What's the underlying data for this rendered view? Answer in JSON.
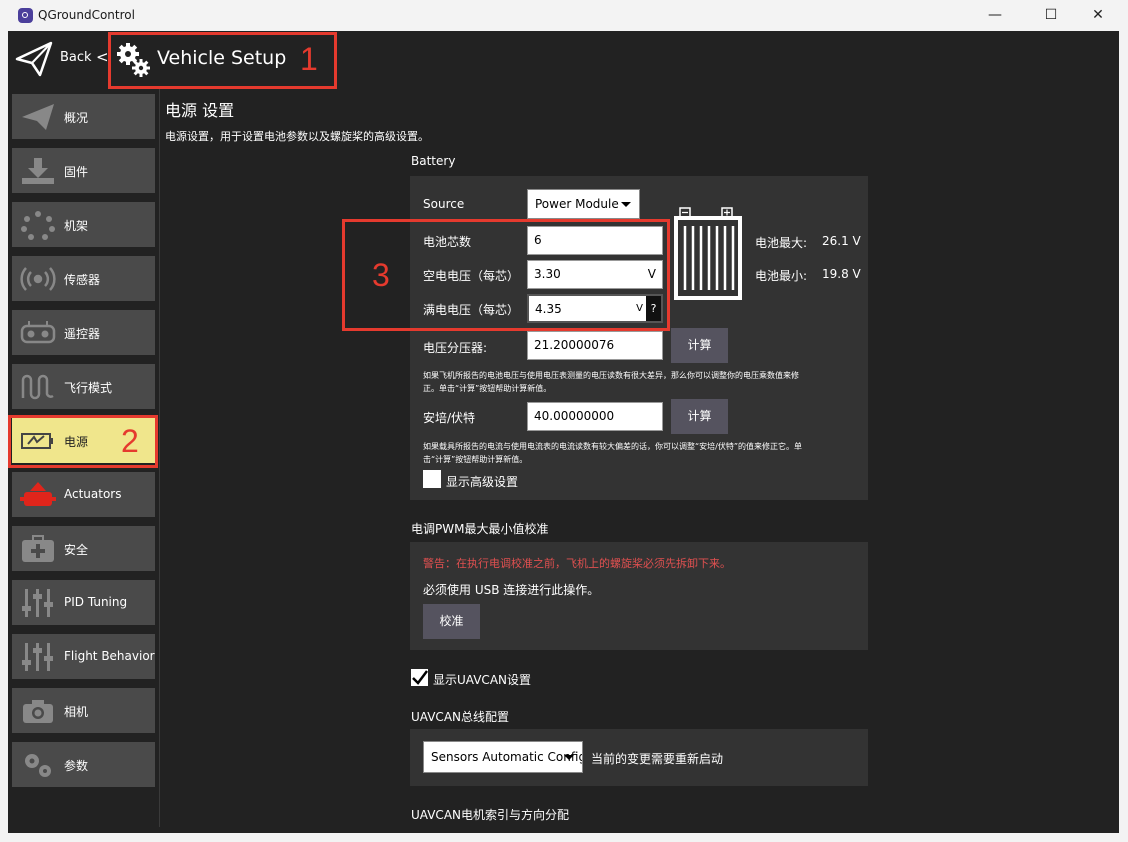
{
  "window": {
    "title": "QGroundControl",
    "minimize": "—",
    "maximize": "☐",
    "close": "✕"
  },
  "toolbar": {
    "back_label": "Back",
    "separator": "<",
    "title": "Vehicle Setup"
  },
  "annotations": {
    "one": "1",
    "two": "2",
    "three": "3"
  },
  "sidebar": {
    "items": [
      {
        "label": "概况",
        "icon": "paper-plane-icon"
      },
      {
        "label": "固件",
        "icon": "download-icon"
      },
      {
        "label": "机架",
        "icon": "airframe-icon"
      },
      {
        "label": "传感器",
        "icon": "radio-waves-icon"
      },
      {
        "label": "遥控器",
        "icon": "remote-controller-icon"
      },
      {
        "label": "飞行模式",
        "icon": "flight-mode-icon"
      },
      {
        "label": "电源",
        "icon": "battery-icon"
      },
      {
        "label": "Actuators",
        "icon": "actuators-icon"
      },
      {
        "label": "安全",
        "icon": "first-aid-icon"
      },
      {
        "label": "PID Tuning",
        "icon": "sliders-icon"
      },
      {
        "label": "Flight Behavior",
        "icon": "sliders-icon"
      },
      {
        "label": "相机",
        "icon": "camera-icon"
      },
      {
        "label": "参数",
        "icon": "gears-icon"
      }
    ]
  },
  "page": {
    "title": "电源 设置",
    "description": "电源设置，用于设置电池参数以及螺旋桨的高级设置。"
  },
  "battery": {
    "section_label": "Battery",
    "source_label": "Source",
    "source_value": "Power Module",
    "cells_label": "电池芯数",
    "cells_value": "6",
    "empty_label": "空电电压（每芯）",
    "empty_value": "3.30",
    "empty_unit": "V",
    "full_label": "满电电压（每芯）",
    "full_value": "4.35",
    "full_unit": "V",
    "help_label": "?",
    "max_label": "电池最大:",
    "max_value": "26.1 V",
    "min_label": "电池最小:",
    "min_value": "19.8 V",
    "divider_label": "电压分压器:",
    "divider_value": "21.20000076",
    "calc_label": "计算",
    "divider_note1": "如果飞机所报告的电池电压与使用电压表测量的电压读数有很大差异，那么你可以调整你的电压乘数值来修",
    "divider_note2": "正。单击“计算”按钮帮助计算新值。",
    "amps_label": "安培/伏特",
    "amps_value": "40.00000000",
    "amps_note1": "如果载具所报告的电流与使用电流表的电流读数有较大偏差的话，你可以调整“安培/伏特”的值来修正它。单",
    "amps_note2": "击“计算”按钮帮助计算新值。",
    "advanced_label": "显示高级设置"
  },
  "esc": {
    "section_label": "电调PWM最大最小值校准",
    "warning": "警告：在执行电调校准之前，飞机上的螺旋桨必须先拆卸下来。",
    "usb_note": "必须使用 USB 连接进行此操作。",
    "calibrate_label": "校准",
    "warning_color": "#e05050"
  },
  "uavcan": {
    "show_label": "显示UAVCAN设置",
    "bus_section_label": "UAVCAN总线配置",
    "bus_value": "Sensors Automatic Config",
    "restart_note": "当前的变更需要重新启动",
    "motor_section_label": "UAVCAN电机索引与方向分配"
  }
}
